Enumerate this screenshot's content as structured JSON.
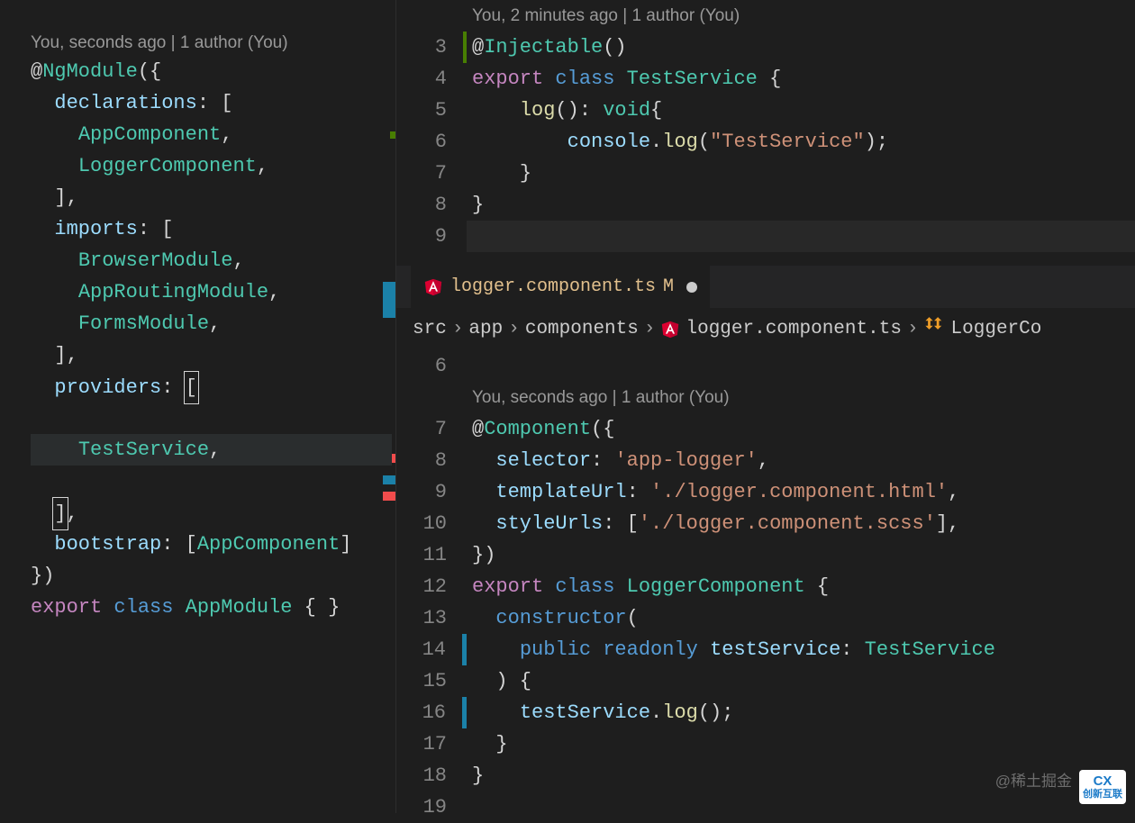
{
  "left": {
    "codelens": "You, seconds ago | 1 author (You)",
    "decorator": "NgModule",
    "keys": {
      "declarations": "declarations",
      "imports": "imports",
      "providers": "providers",
      "bootstrap": "bootstrap"
    },
    "declarations": [
      "AppComponent",
      "LoggerComponent"
    ],
    "importsList": [
      "BrowserModule",
      "AppRoutingModule",
      "FormsModule"
    ],
    "providers": [
      "TestService"
    ],
    "bootstrapList": [
      "AppComponent"
    ],
    "exportKw": "export",
    "classKw": "class",
    "className": "AppModule"
  },
  "top": {
    "codelens": "You, 2 minutes ago | 1 author (You)",
    "lines": {
      "3": {
        "at": "@",
        "decor": "Injectable",
        "paren": "()"
      },
      "4": {
        "exp": "export",
        "cls": "class",
        "name": "TestService",
        "brace": "{"
      },
      "5": {
        "fn": "log",
        "sig": "():",
        "ret": "void",
        "brace2": "{"
      },
      "6": {
        "obj": "console",
        "dot": ".",
        "m": "log",
        "open": "(",
        "str": "\"TestService\"",
        "close": ");"
      },
      "7": {
        "close": "}"
      },
      "8": {
        "close": "}"
      }
    },
    "lineNumbers": [
      "3",
      "4",
      "5",
      "6",
      "7",
      "8",
      "9"
    ]
  },
  "tab": {
    "filename": "logger.component.ts",
    "modified": "M"
  },
  "breadcrumb": {
    "segs": [
      "src",
      "app",
      "components",
      "logger.component.ts",
      "LoggerCo"
    ]
  },
  "bottom": {
    "codelens": "You, seconds ago | 1 author (You)",
    "lineNumbers": [
      "6",
      "7",
      "8",
      "9",
      "10",
      "11",
      "12",
      "13",
      "14",
      "15",
      "16",
      "17",
      "18",
      "19"
    ],
    "decor": "Component",
    "props": {
      "selector": {
        "k": "selector",
        "v": "'app-logger'"
      },
      "templateUrl": {
        "k": "templateUrl",
        "v": "'./logger.component.html'"
      },
      "styleUrls": {
        "k": "styleUrls",
        "v": "'./logger.component.scss'"
      }
    },
    "exportKw": "export",
    "classKw": "class",
    "className": "LoggerComponent",
    "ctor": "constructor",
    "pub": "public",
    "ro": "readonly",
    "param": "testService",
    "paramType": "TestService",
    "call": {
      "obj": "testService",
      "m": "log"
    }
  },
  "watermark": "@稀土掘金",
  "logo": {
    "cx": "CX",
    "sub": "创新互联"
  }
}
